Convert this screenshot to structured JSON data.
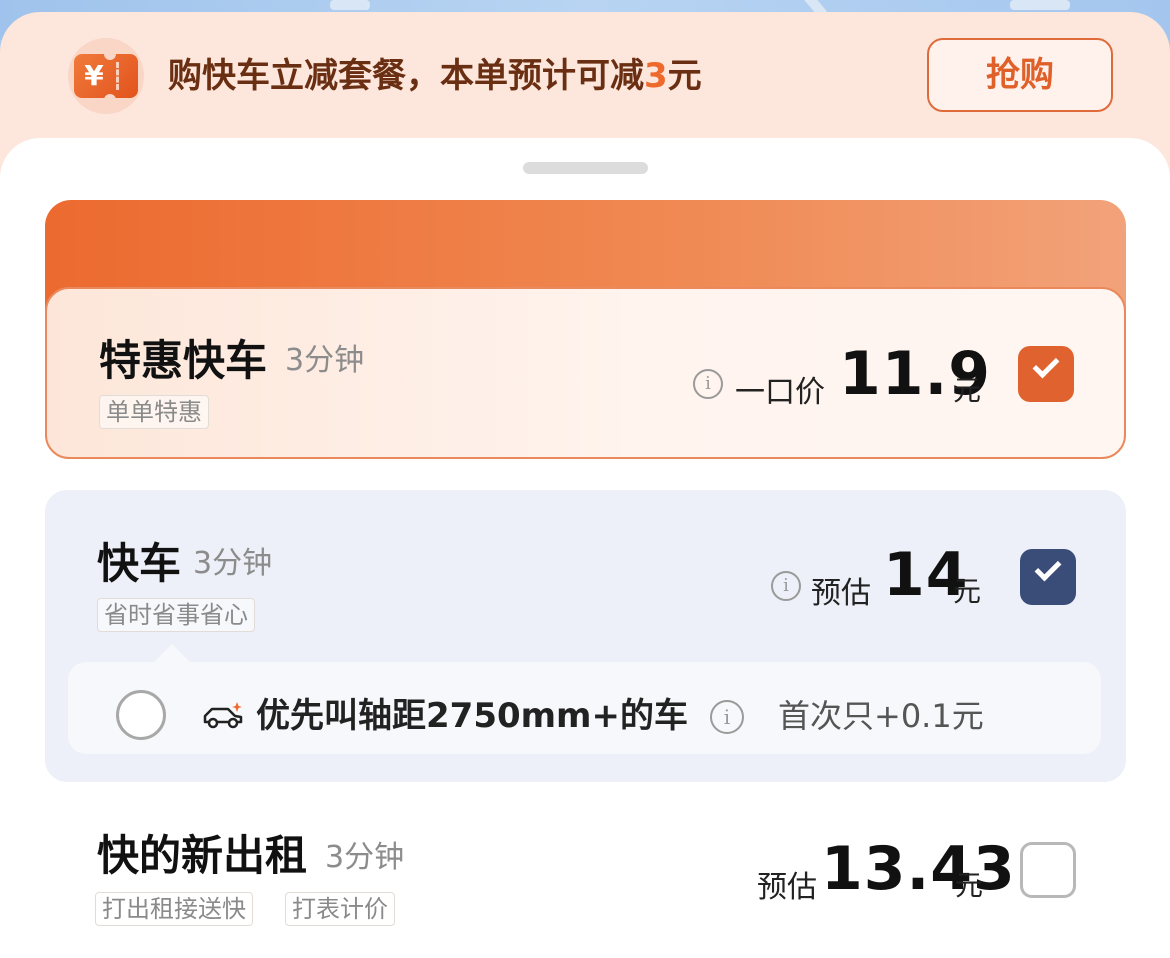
{
  "promo": {
    "icon": "yen-ticket-icon",
    "currency_symbol": "¥",
    "text_main": "购快车立减套餐，本单预计可减",
    "text_amount": "3",
    "text_unit": "元",
    "button_label": "抢购",
    "accent_color": "#ee6a2c"
  },
  "rides": [
    {
      "name": "特惠快车",
      "eta": "3分钟",
      "tags": [
        "单单特惠"
      ],
      "price_label": "一口价",
      "price": "11.9",
      "unit": "元",
      "selected": true,
      "check_color": "#e0622f"
    },
    {
      "name": "快车",
      "eta": "3分钟",
      "tags": [
        "省时省事省心"
      ],
      "price_label": "预估",
      "price": "14",
      "unit": "元",
      "selected": true,
      "check_color": "#3a4d78",
      "sub_option": {
        "text": "优先叫轴距2750mm+的车",
        "extra": "首次只+0.1元",
        "selected": false
      }
    },
    {
      "name": "快的新出租",
      "eta": "3分钟",
      "tags": [
        "打出租接送快",
        "打表计价"
      ],
      "price_label": "预估",
      "price": "13.43",
      "unit": "元",
      "selected": false
    }
  ],
  "info_glyph": "i"
}
